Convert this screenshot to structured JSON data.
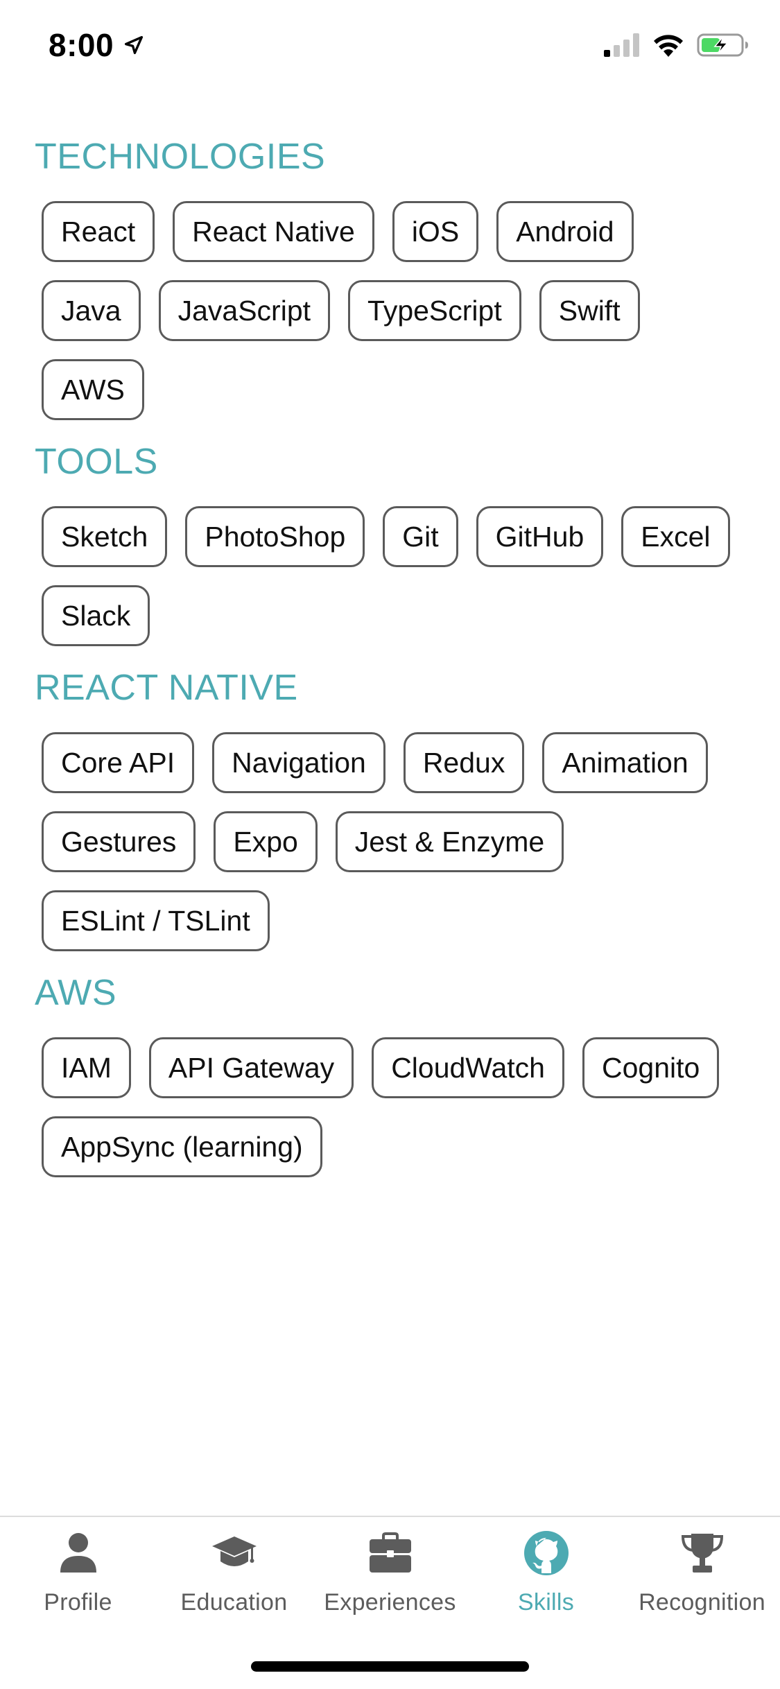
{
  "status_bar": {
    "time": "8:00"
  },
  "colors": {
    "accent": "#4daab2",
    "chip_border": "#5a5a5a",
    "tab_inactive": "#5c5c5c",
    "battery_green": "#4cd964"
  },
  "sections": [
    {
      "title": "TECHNOLOGIES",
      "chips": [
        "React",
        "React Native",
        "iOS",
        "Android",
        "Java",
        "JavaScript",
        "TypeScript",
        "Swift",
        "AWS"
      ]
    },
    {
      "title": "TOOLS",
      "chips": [
        "Sketch",
        "PhotoShop",
        "Git",
        "GitHub",
        "Excel",
        "Slack"
      ]
    },
    {
      "title": "REACT NATIVE",
      "chips": [
        "Core API",
        "Navigation",
        "Redux",
        "Animation",
        "Gestures",
        "Expo",
        "Jest & Enzyme",
        "ESLint / TSLint"
      ]
    },
    {
      "title": "AWS",
      "chips": [
        "IAM",
        "API Gateway",
        "CloudWatch",
        "Cognito",
        "AppSync (learning)"
      ]
    }
  ],
  "tab_bar": {
    "active": "skills",
    "tabs": [
      {
        "label": "Profile",
        "icon": "person-icon"
      },
      {
        "label": "Education",
        "icon": "graduation-cap-icon"
      },
      {
        "label": "Experiences",
        "icon": "briefcase-icon"
      },
      {
        "label": "Skills",
        "icon": "github-icon"
      },
      {
        "label": "Recognition",
        "icon": "trophy-icon"
      }
    ]
  }
}
